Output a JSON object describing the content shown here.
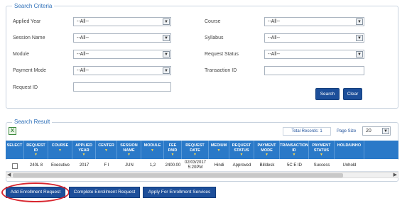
{
  "search_criteria": {
    "legend": "Search Criteria",
    "fields": [
      {
        "label": "Applied Year",
        "value": "--All--"
      },
      {
        "label": "Session Name",
        "value": "--All--"
      },
      {
        "label": "Module",
        "value": "--All--"
      },
      {
        "label": "Payment Mode",
        "value": "--All--"
      },
      {
        "label": "Request ID",
        "value": ""
      },
      {
        "label": "Course",
        "value": "--All--"
      },
      {
        "label": "Syllabus",
        "value": "--All--"
      },
      {
        "label": "Request Status",
        "value": "--All--"
      },
      {
        "label": "Transaction ID",
        "value": ""
      }
    ],
    "search_label": "Search",
    "clear_label": "Clear"
  },
  "search_result": {
    "legend": "Search Result",
    "total_records_label": "Total Records: 1",
    "page_size_label": "Page Size",
    "page_size_value": "20",
    "columns": [
      {
        "label": "SELECT",
        "sortable": false
      },
      {
        "label": "REQUEST ID",
        "sortable": true
      },
      {
        "label": "COURSE",
        "sortable": true
      },
      {
        "label": "APPLIED YEAR",
        "sortable": true
      },
      {
        "label": "CENTER",
        "sortable": true
      },
      {
        "label": "SESSION NAME",
        "sortable": true
      },
      {
        "label": "MODULE",
        "sortable": true
      },
      {
        "label": "FEE PAID",
        "sortable": true
      },
      {
        "label": "REQUEST DATE",
        "sortable": true
      },
      {
        "label": "MEDIUM",
        "sortable": true
      },
      {
        "label": "REQUEST STATUS",
        "sortable": true
      },
      {
        "label": "PAYMENT MODE",
        "sortable": true
      },
      {
        "label": "TRANSACTION ID",
        "sortable": true
      },
      {
        "label": "PAYMENT STATUS",
        "sortable": true
      },
      {
        "label": "HOLD/UNHO",
        "sortable": false
      }
    ],
    "rows": [
      [
        "",
        "240L  8",
        "Executive",
        "2017",
        "F  I",
        "JUN",
        "1,2",
        "2400.00",
        "02/03/2017 5:20PM",
        "Hindi",
        "Approved",
        "Billdesk",
        "5C  E  ID",
        "Success",
        "Unhold"
      ]
    ]
  },
  "actions": {
    "add_enrollment": "Add Enrollment Request",
    "complete_enrollment": "Complete Enrollment Request",
    "apply_services": "Apply For Enrollment Services"
  },
  "colors": {
    "grid_header": "#2a79c8",
    "button": "#1d4f9a",
    "legend_text": "#2d6fb8",
    "highlight_circle": "#d8262f"
  }
}
